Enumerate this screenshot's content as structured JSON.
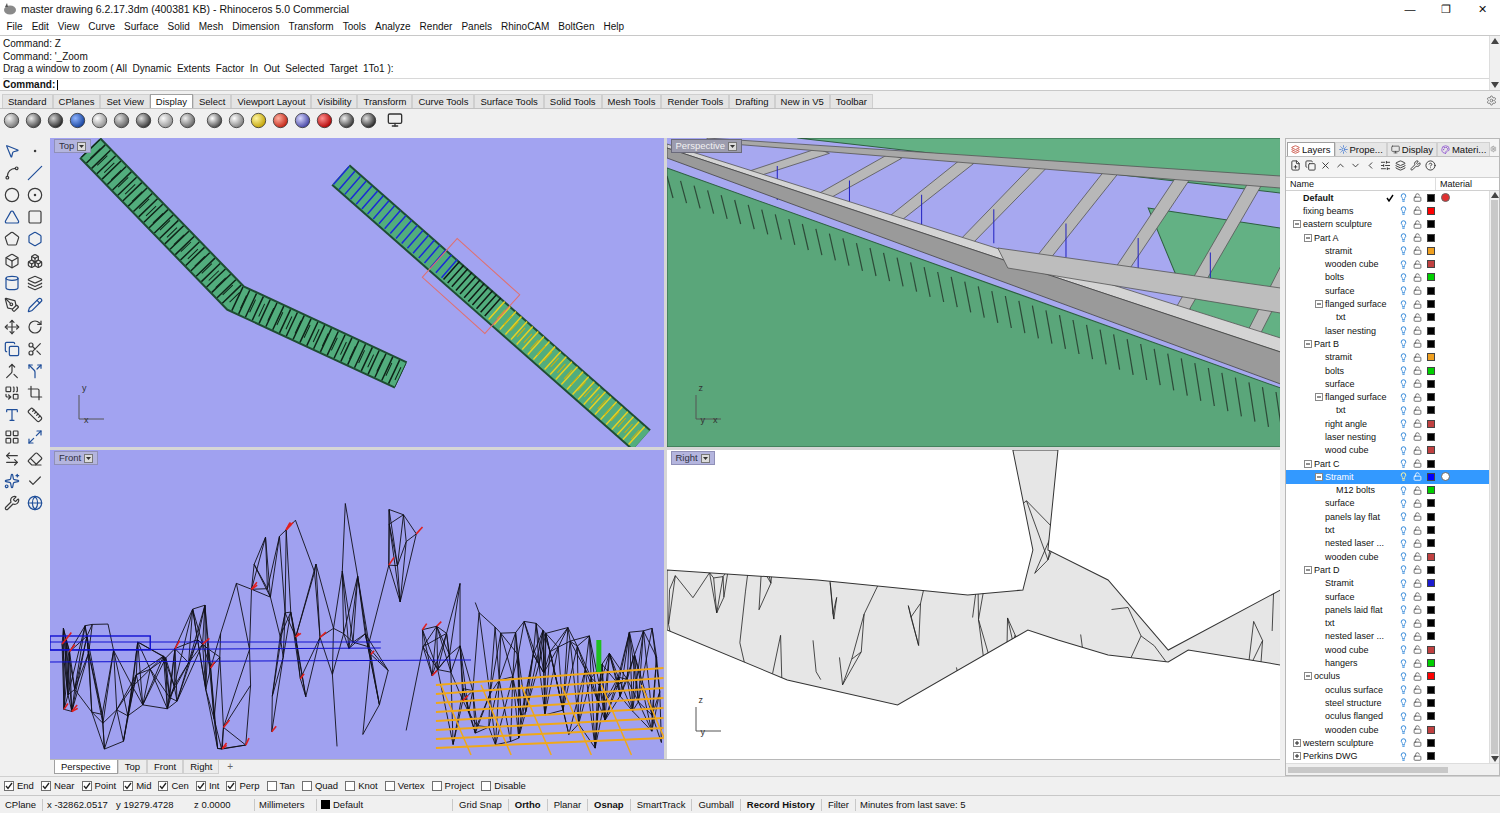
{
  "window": {
    "title": "master drawing 6.2.17.3dm (400381 KB) - Rhinoceros 5.0 Commercial",
    "controls": [
      "—",
      "❐",
      "✕"
    ]
  },
  "menu": [
    "File",
    "Edit",
    "View",
    "Curve",
    "Surface",
    "Solid",
    "Mesh",
    "Dimension",
    "Transform",
    "Tools",
    "Analyze",
    "Render",
    "Panels",
    "RhinoCAM",
    "BoltGen",
    "Help"
  ],
  "command_history": [
    "Command: Z",
    "Command: '_Zoom",
    "Drag a window to zoom ( All  Dynamic  Extents  Factor  In  Out  Selected  Target  1To1 ):"
  ],
  "command_prompt": "Command:",
  "toolbar_tabs": [
    {
      "label": "Standard",
      "selected": false
    },
    {
      "label": "CPlanes",
      "selected": false
    },
    {
      "label": "Set View",
      "selected": false
    },
    {
      "label": "Display",
      "selected": true
    },
    {
      "label": "Select",
      "selected": false
    },
    {
      "label": "Viewport Layout",
      "selected": false
    },
    {
      "label": "Visibility",
      "selected": false
    },
    {
      "label": "Transform",
      "selected": false
    },
    {
      "label": "Curve Tools",
      "selected": false
    },
    {
      "label": "Surface Tools",
      "selected": false
    },
    {
      "label": "Solid Tools",
      "selected": false
    },
    {
      "label": "Mesh Tools",
      "selected": false
    },
    {
      "label": "Render Tools",
      "selected": false
    },
    {
      "label": "Drafting",
      "selected": false
    },
    {
      "label": "New in V5",
      "selected": false
    },
    {
      "label": "Toolbar",
      "selected": false
    }
  ],
  "viewports": [
    {
      "name": "Top",
      "active": false,
      "axes": [
        "y",
        "x"
      ]
    },
    {
      "name": "Perspective",
      "active": true,
      "axes": [
        "z",
        "y",
        "x"
      ]
    },
    {
      "name": "Front",
      "active": false,
      "axes": []
    },
    {
      "name": "Right",
      "active": false,
      "axes": [
        "z",
        "y"
      ]
    }
  ],
  "viewport_tabs": [
    {
      "label": "Perspective",
      "selected": true
    },
    {
      "label": "Top",
      "selected": false
    },
    {
      "label": "Front",
      "selected": false
    },
    {
      "label": "Right",
      "selected": false
    }
  ],
  "add_tab": "+",
  "layers_panel": {
    "tabs": [
      {
        "label": "Layers",
        "selected": true
      },
      {
        "label": "Prope...",
        "selected": false
      },
      {
        "label": "Display",
        "selected": false
      },
      {
        "label": "Materi...",
        "selected": false
      }
    ],
    "columns": [
      "Name",
      "Material"
    ],
    "layers": [
      {
        "name": "Default",
        "depth": 0,
        "selected": false,
        "current": true,
        "color": "#000000",
        "material_color": "#e03030"
      },
      {
        "name": "fixing beams",
        "depth": 0,
        "selected": false,
        "current": false,
        "color": "#ff0000"
      },
      {
        "name": "eastern sculpture",
        "depth": 0,
        "selected": false,
        "current": false,
        "color": "#000000",
        "expanded": true
      },
      {
        "name": "Part A",
        "depth": 1,
        "selected": false,
        "current": false,
        "color": "#000000",
        "expanded": true
      },
      {
        "name": "stramit",
        "depth": 2,
        "selected": false,
        "current": false,
        "color": "#f0a020"
      },
      {
        "name": "wooden cube",
        "depth": 2,
        "selected": false,
        "current": false,
        "color": "#c04040"
      },
      {
        "name": "bolts",
        "depth": 2,
        "selected": false,
        "current": false,
        "color": "#00d000"
      },
      {
        "name": "surface",
        "depth": 2,
        "selected": false,
        "current": false,
        "color": "#000000"
      },
      {
        "name": "flanged surface",
        "depth": 2,
        "selected": false,
        "current": false,
        "color": "#000000",
        "expanded": true
      },
      {
        "name": "txt",
        "depth": 3,
        "selected": false,
        "current": false,
        "color": "#000000"
      },
      {
        "name": "laser nesting",
        "depth": 2,
        "selected": false,
        "current": false,
        "color": "#000000"
      },
      {
        "name": "Part B",
        "depth": 1,
        "selected": false,
        "current": false,
        "color": "#000000",
        "expanded": true
      },
      {
        "name": "stramit",
        "depth": 2,
        "selected": false,
        "current": false,
        "color": "#f0a020"
      },
      {
        "name": "bolts",
        "depth": 2,
        "selected": false,
        "current": false,
        "color": "#00d000"
      },
      {
        "name": "surface",
        "depth": 2,
        "selected": false,
        "current": false,
        "color": "#000000"
      },
      {
        "name": "flanged surface",
        "depth": 2,
        "selected": false,
        "current": false,
        "color": "#000000",
        "expanded": true
      },
      {
        "name": "txt",
        "depth": 3,
        "selected": false,
        "current": false,
        "color": "#000000"
      },
      {
        "name": "right angle",
        "depth": 2,
        "selected": false,
        "current": false,
        "color": "#c04040"
      },
      {
        "name": "laser nesting",
        "depth": 2,
        "selected": false,
        "current": false,
        "color": "#000000"
      },
      {
        "name": "wood cube",
        "depth": 2,
        "selected": false,
        "current": false,
        "color": "#c04040"
      },
      {
        "name": "Part C",
        "depth": 1,
        "selected": false,
        "current": false,
        "color": "#000000",
        "expanded": true
      },
      {
        "name": "Stramit",
        "depth": 2,
        "selected": true,
        "current": false,
        "color": "#0000ff",
        "expanded": true,
        "material_color": "#ffffff"
      },
      {
        "name": "M12 bolts",
        "depth": 3,
        "selected": false,
        "current": false,
        "color": "#00d000"
      },
      {
        "name": "surface",
        "depth": 2,
        "selected": false,
        "current": false,
        "color": "#000000"
      },
      {
        "name": "panels lay flat",
        "depth": 2,
        "selected": false,
        "current": false,
        "color": "#000000"
      },
      {
        "name": "txt",
        "depth": 2,
        "selected": false,
        "current": false,
        "color": "#000000"
      },
      {
        "name": "nested laser ...",
        "depth": 2,
        "selected": false,
        "current": false,
        "color": "#000000"
      },
      {
        "name": "wooden cube",
        "depth": 2,
        "selected": false,
        "current": false,
        "color": "#c04040"
      },
      {
        "name": "Part D",
        "depth": 1,
        "selected": false,
        "current": false,
        "color": "#000000",
        "expanded": true
      },
      {
        "name": "Stramit",
        "depth": 2,
        "selected": false,
        "current": false,
        "color": "#1a1ad0"
      },
      {
        "name": "surface",
        "depth": 2,
        "selected": false,
        "current": false,
        "color": "#000000"
      },
      {
        "name": "panels laid flat",
        "depth": 2,
        "selected": false,
        "current": false,
        "color": "#000000"
      },
      {
        "name": "txt",
        "depth": 2,
        "selected": false,
        "current": false,
        "color": "#000000"
      },
      {
        "name": "nested laser ...",
        "depth": 2,
        "selected": false,
        "current": false,
        "color": "#000000"
      },
      {
        "name": "wood cube",
        "depth": 2,
        "selected": false,
        "current": false,
        "color": "#c04040"
      },
      {
        "name": "hangers",
        "depth": 2,
        "selected": false,
        "current": false,
        "color": "#00d000"
      },
      {
        "name": "oculus",
        "depth": 1,
        "selected": false,
        "current": false,
        "color": "#ff0000",
        "expanded": true
      },
      {
        "name": "oculus surface",
        "depth": 2,
        "selected": false,
        "current": false,
        "color": "#000000"
      },
      {
        "name": "steel structure",
        "depth": 2,
        "selected": false,
        "current": false,
        "color": "#000000"
      },
      {
        "name": "oculus flanged",
        "depth": 2,
        "selected": false,
        "current": false,
        "color": "#000000"
      },
      {
        "name": "wooden cube",
        "depth": 2,
        "selected": false,
        "current": false,
        "color": "#c04040"
      },
      {
        "name": "western sculpture",
        "depth": 0,
        "selected": false,
        "current": false,
        "color": "#000000",
        "expanded": false
      },
      {
        "name": "Perkins DWG",
        "depth": 0,
        "selected": false,
        "current": false,
        "color": "#000000",
        "expanded": false
      }
    ]
  },
  "osnaps": [
    {
      "label": "End",
      "checked": true
    },
    {
      "label": "Near",
      "checked": true
    },
    {
      "label": "Point",
      "checked": true
    },
    {
      "label": "Mid",
      "checked": true
    },
    {
      "label": "Cen",
      "checked": true
    },
    {
      "label": "Int",
      "checked": true
    },
    {
      "label": "Perp",
      "checked": true
    },
    {
      "label": "Tan",
      "checked": false
    },
    {
      "label": "Quad",
      "checked": false
    },
    {
      "label": "Knot",
      "checked": false
    },
    {
      "label": "Vertex",
      "checked": false
    },
    {
      "label": "Project",
      "checked": false
    },
    {
      "label": "Disable",
      "checked": false
    }
  ],
  "status_bar": {
    "cplane": "CPlane",
    "x": "x -32862.0517",
    "y": "y 19279.4728",
    "z": "z 0.0000",
    "units": "Millimeters",
    "layer": "Default",
    "layer_color": "#000000",
    "toggles": [
      {
        "label": "Grid Snap",
        "on": false
      },
      {
        "label": "Ortho",
        "on": true
      },
      {
        "label": "Planar",
        "on": false
      },
      {
        "label": "Osnap",
        "on": true
      },
      {
        "label": "SmartTrack",
        "on": false
      },
      {
        "label": "Gumball",
        "on": false
      },
      {
        "label": "Record History",
        "on": true
      },
      {
        "label": "Filter",
        "on": false
      }
    ],
    "message": "Minutes from last save: 5"
  }
}
